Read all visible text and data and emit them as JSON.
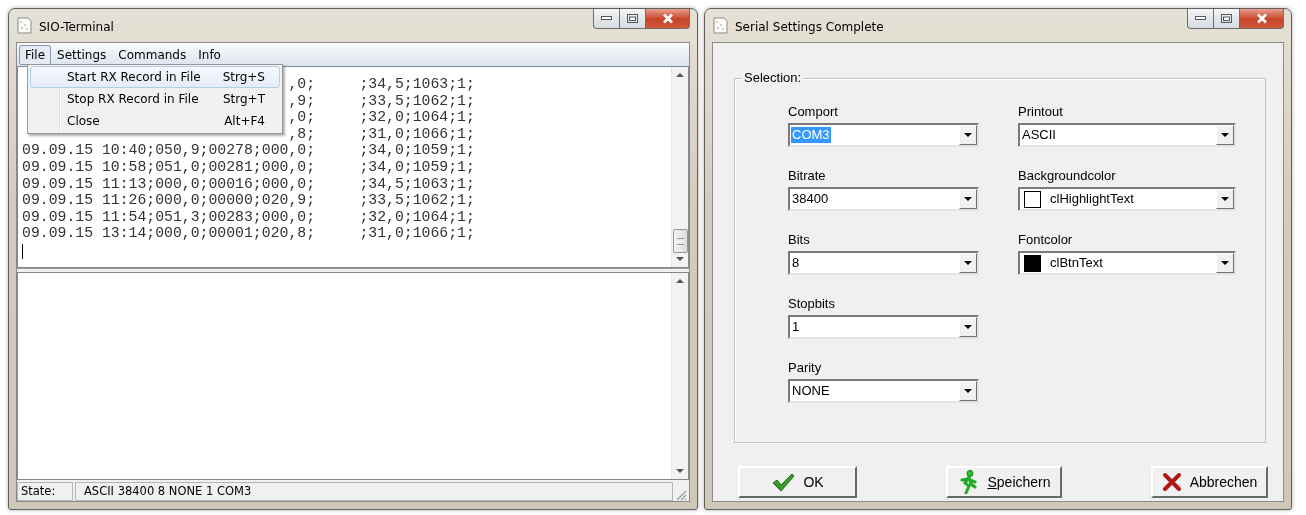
{
  "terminal": {
    "title": "SIO-Terminal",
    "menu": [
      {
        "label": "File",
        "selected": true
      },
      {
        "label": "Settings",
        "selected": false
      },
      {
        "label": "Commands",
        "selected": false
      },
      {
        "label": "Info",
        "selected": false
      }
    ],
    "file_menu": [
      {
        "label": "Start RX Record in File",
        "shortcut": "Strg+S",
        "selected": true
      },
      {
        "label": "Stop RX Record in File",
        "shortcut": "Strg+T",
        "selected": false
      },
      {
        "label": "Close",
        "shortcut": "Alt+F4",
        "selected": false
      }
    ],
    "lines": [
      {
        "left": ",0;",
        "right": ";34,5;1063;1;"
      },
      {
        "left": ",9;",
        "right": ";33,5;1062;1;"
      },
      {
        "left": ",0;",
        "right": ";32,0;1064;1;"
      },
      {
        "left": ",8;",
        "right": ";31,0;1066;1;"
      },
      {
        "left": "09.09.15 10:40;050,9;00278;000,0;",
        "right": ";34,0;1059;1;"
      },
      {
        "left": "09.09.15 10:58;051,0;00281;000,0;",
        "right": ";34,0;1059;1;"
      },
      {
        "left": "09.09.15 11:13;000,0;00016;000,0;",
        "right": ";34,5;1063;1;"
      },
      {
        "left": "09.09.15 11:26;000,0;00000;020,9;",
        "right": ";33,5;1062;1;"
      },
      {
        "left": "09.09.15 11:54;051,3;00283;000,0;",
        "right": ";32,0;1064;1;"
      },
      {
        "left": "09.09.15 13:14;000,0;00001;020,8;",
        "right": ";31,0;1066;1;"
      }
    ],
    "status_label": "State:",
    "status_text": "ASCII 38400 8 NONE 1 COM3"
  },
  "dialog": {
    "title": "Serial Settings Complete",
    "group_label": "Selection:",
    "columns": [
      [
        {
          "label": "Comport",
          "value": "COM3",
          "value_selected": true
        },
        {
          "label": "Bitrate",
          "value": "38400",
          "value_selected": false
        },
        {
          "label": "Bits",
          "value": "8",
          "value_selected": false
        },
        {
          "label": "Stopbits",
          "value": "1",
          "value_selected": false
        },
        {
          "label": "Parity",
          "value": "NONE",
          "value_selected": false
        }
      ],
      [
        {
          "label": "Printout",
          "value": "ASCII",
          "value_selected": false
        },
        {
          "label": "Backgroundcolor",
          "value": "clHighlightText",
          "value_selected": false,
          "color": "#ffffff"
        },
        {
          "label": "Fontcolor",
          "value": "clBtnText",
          "value_selected": false,
          "color": "#000000"
        }
      ]
    ],
    "buttons": [
      {
        "label": "OK",
        "kind": "ok",
        "underline_first": false
      },
      {
        "label": "Speichern",
        "kind": "save",
        "underline_first": true
      },
      {
        "label": "Abbrechen",
        "kind": "cancel",
        "underline_first": false
      }
    ]
  }
}
